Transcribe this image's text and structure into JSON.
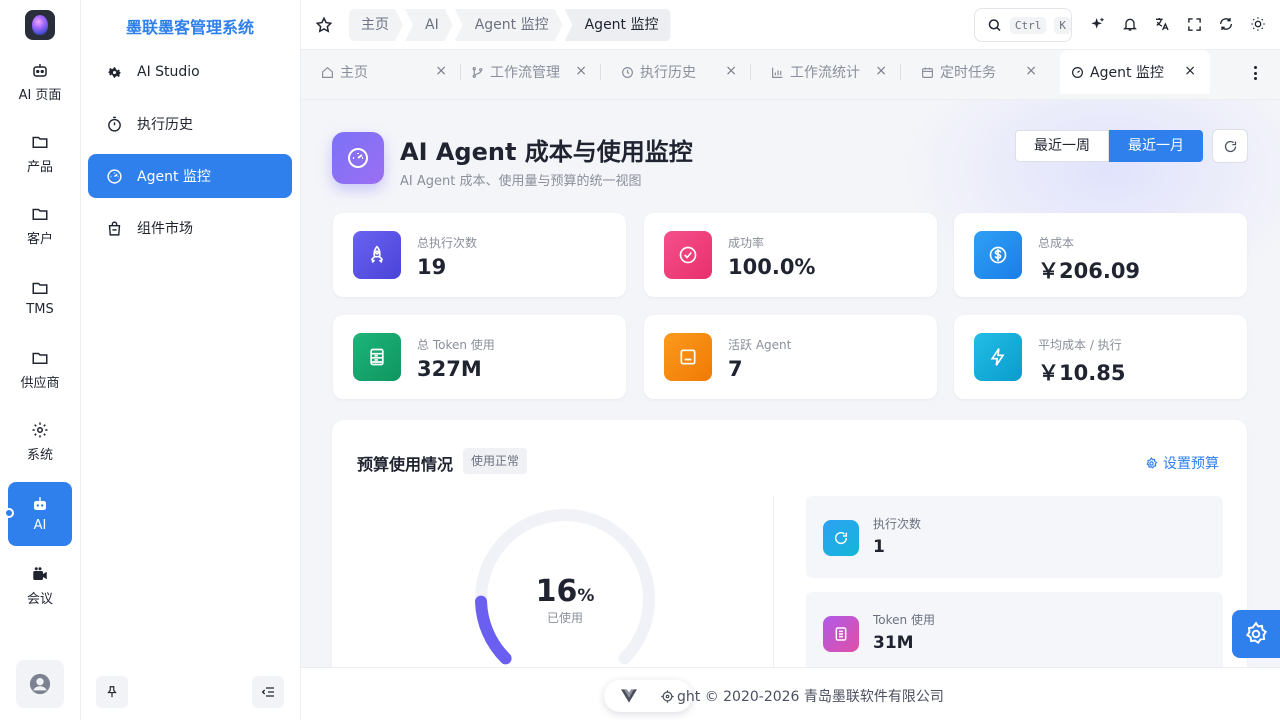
{
  "rail": {
    "items": [
      {
        "label": "AI 页面"
      },
      {
        "label": "产品"
      },
      {
        "label": "客户"
      },
      {
        "label": "TMS"
      },
      {
        "label": "供应商"
      },
      {
        "label": "系统"
      },
      {
        "label": "AI"
      },
      {
        "label": "会议"
      }
    ]
  },
  "menu": {
    "title": "墨联墨客管理系统",
    "items": [
      {
        "label": "AI Studio"
      },
      {
        "label": "执行历史"
      },
      {
        "label": "Agent 监控"
      },
      {
        "label": "组件市场"
      }
    ]
  },
  "topbar": {
    "breadcrumbs": [
      "主页",
      "AI",
      "Agent 监控",
      "Agent 监控"
    ],
    "search": {
      "kbd1": "Ctrl",
      "kbd2": "K"
    }
  },
  "tabs": [
    {
      "label": "主页",
      "icon": "home-icon"
    },
    {
      "label": "工作流管理",
      "icon": "branch-icon"
    },
    {
      "label": "执行历史",
      "icon": "history-icon"
    },
    {
      "label": "工作流统计",
      "icon": "bar-chart-icon"
    },
    {
      "label": "定时任务",
      "icon": "calendar-icon"
    },
    {
      "label": "Agent 监控",
      "icon": "dashboard-icon"
    }
  ],
  "header": {
    "title": "AI Agent 成本与使用监控",
    "subtitle": "AI Agent 成本、使用量与预算的统一视图",
    "range": [
      "最近一周",
      "最近一月"
    ]
  },
  "stats": [
    {
      "label": "总执行次数",
      "value": "19",
      "color": "#5b54e8"
    },
    {
      "label": "成功率",
      "value": "100.0%",
      "color": "#ef3f7c"
    },
    {
      "label": "总成本",
      "value": "￥206.09",
      "color": "#1f8ff0"
    },
    {
      "label": "总 Token 使用",
      "value": "327M",
      "color": "#16a36d"
    },
    {
      "label": "活跃 Agent",
      "value": "7",
      "color": "#f58a0c"
    },
    {
      "label": "平均成本 / 执行",
      "value": "￥10.85",
      "color": "#0fa8d8"
    }
  ],
  "budget": {
    "title": "预算使用情况",
    "tag": "使用正常",
    "settings_label": "设置预算",
    "gauge_value": "16",
    "gauge_unit": "%",
    "gauge_label": "已使用",
    "gauge_fraction": 0.16,
    "items": [
      {
        "label": "执行次数",
        "value": "1"
      },
      {
        "label": "Token 使用",
        "value": "31M"
      }
    ]
  },
  "footer": {
    "text": "ght © 2020-2026  青岛墨联软件有限公司"
  }
}
